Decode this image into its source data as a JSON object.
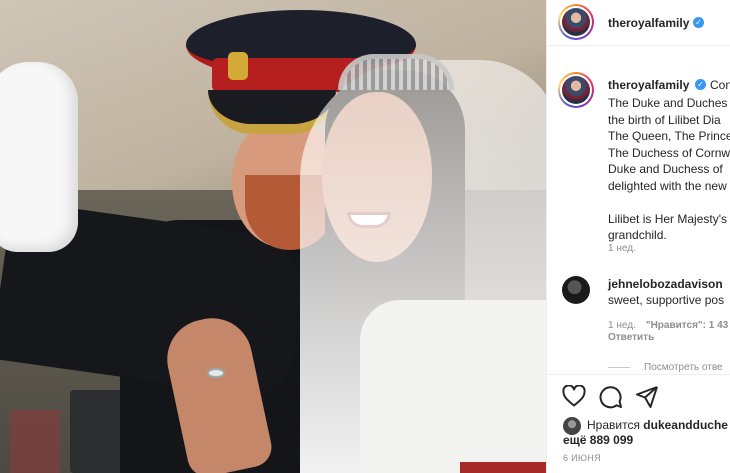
{
  "post": {
    "image_alt": "Photo of the Duke and Duchess of Sussex waving"
  },
  "header": {
    "username": "theroyalfamily",
    "verified_mark": "✓"
  },
  "caption": {
    "username": "theroyalfamily",
    "first_word": "Con",
    "lines": "The Duke and Duches\nthe birth of Lilibet Dia\nThe Queen, The Prince\nThe Duchess of Cornw\nDuke and Duchess of \ndelighted with the new\n\nLilibet is Her Majesty's\ngrandchild.",
    "time": "1 нед."
  },
  "comment": {
    "username": "jehnelobozadavison",
    "text": "sweet, supportive pos",
    "time": "1 нед.",
    "likes": "\"Нравится\": 1 43",
    "reply": "Ответить",
    "view_replies": "Посмотреть отве"
  },
  "actions": {
    "liked_prefix": "Нравится",
    "liked_by": "dukeandduche",
    "liked_count": "ещё 889 099",
    "date": "6 ИЮНЯ"
  },
  "icons": [
    "heart-icon",
    "comment-icon",
    "share-icon",
    "verified-icon"
  ]
}
